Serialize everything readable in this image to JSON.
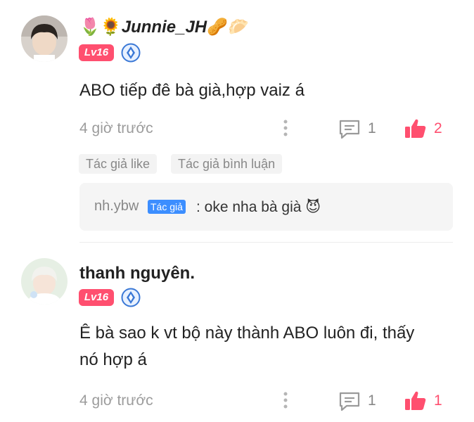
{
  "comments": [
    {
      "name_prefix_emoji": "🌷🌻",
      "name": "Junnie_JH",
      "name_suffix_emoji": "🥜🥟",
      "level": "Lv16",
      "text": "ABO tiếp đê bà già,hợp vaiz á",
      "time": "4 giờ trước",
      "reply_count": "1",
      "like_count": "2",
      "tags": [
        "Tác giả like",
        "Tác giả bình luận"
      ],
      "reply": {
        "author": "nh.ybw",
        "author_badge": "Tác giả",
        "text": ": oke nha bà già 😈"
      }
    },
    {
      "name": "thanh nguyên.",
      "level": "Lv16",
      "text_line1": "Ê bà sao k vt bộ này thành ABO luôn đi, thấy",
      "text_line2": "nó hợp á",
      "time": "4 giờ trước",
      "reply_count": "1",
      "like_count": "1"
    }
  ],
  "colors": {
    "accent_pink": "#ff4f6f",
    "author_badge_blue": "#3c8eff",
    "muted_text": "#9c9c9c"
  },
  "icons": [
    "comment-bubble-icon",
    "thumbs-up-icon",
    "more-vertical-icon",
    "medal-icon"
  ]
}
